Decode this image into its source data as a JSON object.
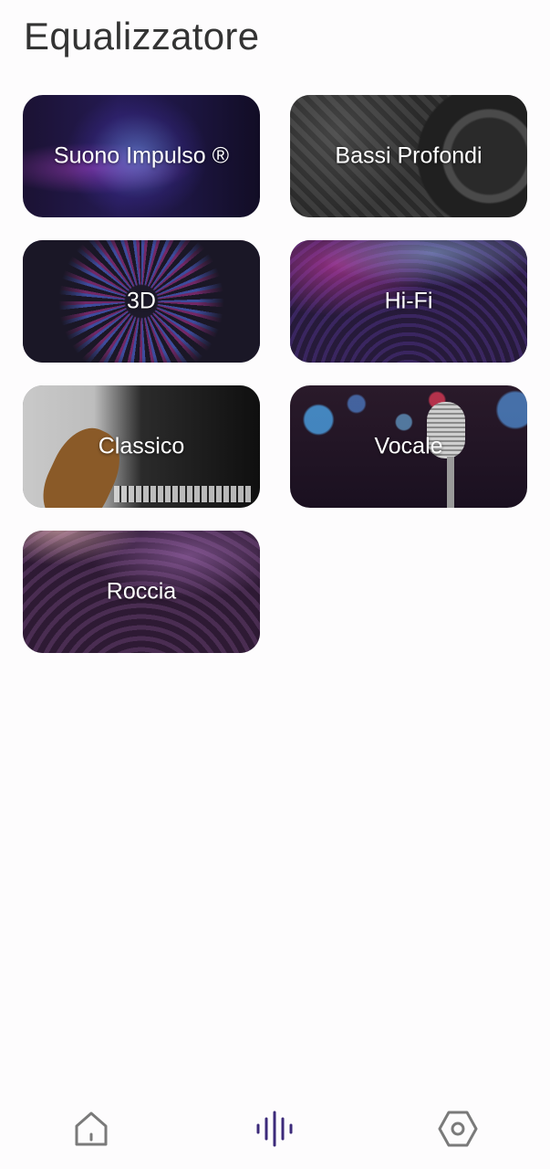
{
  "header": {
    "title": "Equalizzatore"
  },
  "presets": [
    {
      "label": "Suono Impulso ®"
    },
    {
      "label": "Bassi Profondi"
    },
    {
      "label": "3D"
    },
    {
      "label": "Hi-Fi"
    },
    {
      "label": "Classico"
    },
    {
      "label": "Vocale"
    },
    {
      "label": "Roccia"
    }
  ],
  "nav": {
    "items": [
      {
        "icon": "home-icon",
        "active": false
      },
      {
        "icon": "equalizer-icon",
        "active": true
      },
      {
        "icon": "settings-icon",
        "active": false
      }
    ],
    "active_color": "#3c2a7a",
    "inactive_color": "#7a7a7a"
  }
}
